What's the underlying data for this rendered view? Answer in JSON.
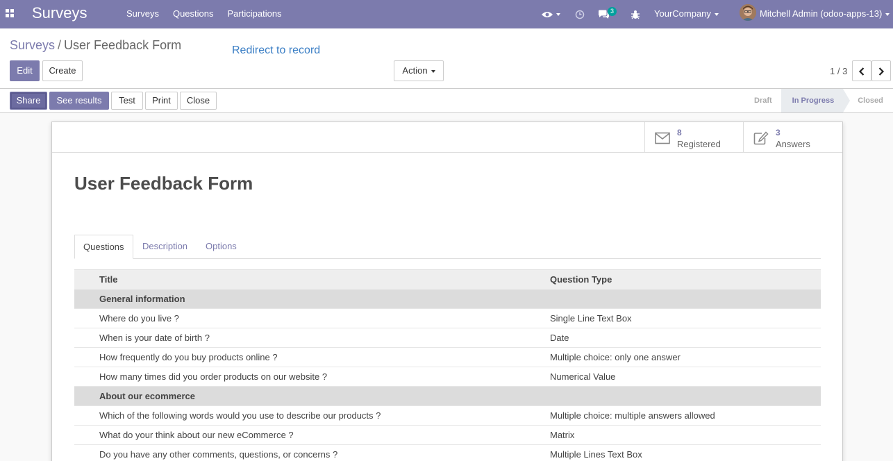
{
  "app": {
    "brand": "Surveys",
    "menu": [
      "Surveys",
      "Questions",
      "Participations"
    ],
    "company": "YourCompany",
    "user": "Mitchell Admin (odoo-apps-13)",
    "chat_count": "3"
  },
  "breadcrumb": {
    "parent": "Surveys",
    "separator": "/",
    "current": "User Feedback Form"
  },
  "redirect_label": "Redirect to record",
  "buttons": {
    "edit": "Edit",
    "create": "Create",
    "action": "Action",
    "share": "Share",
    "see_results": "See results",
    "test": "Test",
    "print": "Print",
    "close": "Close"
  },
  "pager": "1 / 3",
  "statusbar": [
    "Draft",
    "In Progress",
    "Closed"
  ],
  "stats": {
    "registered_value": "8",
    "registered_label": "Registered",
    "answers_value": "3",
    "answers_label": "Answers"
  },
  "form_title": "User Feedback Form",
  "tabs": [
    "Questions",
    "Description",
    "Options"
  ],
  "table": {
    "headers": [
      "Title",
      "Question Type"
    ],
    "rows": [
      {
        "section": true,
        "title": "General information",
        "type": ""
      },
      {
        "section": false,
        "title": "Where do you live ?",
        "type": "Single Line Text Box"
      },
      {
        "section": false,
        "title": "When is your date of birth ?",
        "type": "Date"
      },
      {
        "section": false,
        "title": "How frequently do you buy products online ?",
        "type": "Multiple choice: only one answer"
      },
      {
        "section": false,
        "title": "How many times did you order products on our website ?",
        "type": "Numerical Value"
      },
      {
        "section": true,
        "title": "About our ecommerce",
        "type": ""
      },
      {
        "section": false,
        "title": "Which of the following words would you use to describe our products ?",
        "type": "Multiple choice: multiple answers allowed"
      },
      {
        "section": false,
        "title": "What do your think about our new eCommerce ?",
        "type": "Matrix"
      },
      {
        "section": false,
        "title": "Do you have any other comments, questions, or concerns ?",
        "type": "Multiple Lines Text Box"
      }
    ]
  },
  "colors": {
    "brand": "#7c7bad",
    "link": "#3a7ec5",
    "badge": "#00a09d"
  }
}
